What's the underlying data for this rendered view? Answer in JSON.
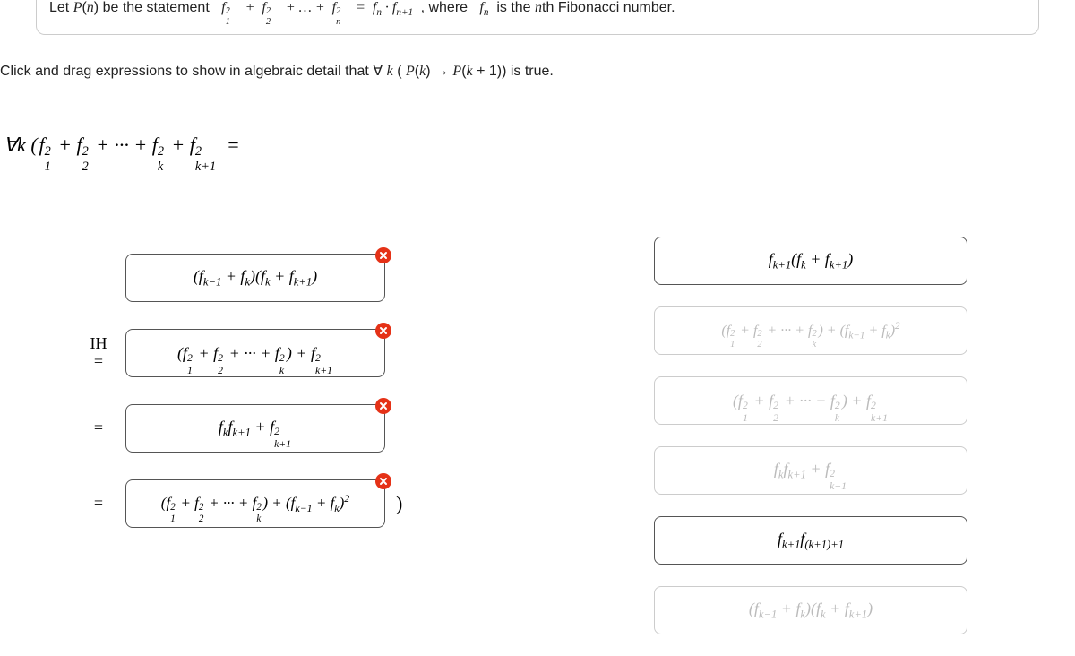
{
  "statement": {
    "pre": "Let ",
    "pn": "P(n)",
    "mid1": " be the statement  ",
    "eq_lhs": "f₁² + f₂² + … + fₙ² = fₙ · fₙ₊₁",
    "mid2": " , where  ",
    "fn": "fₙ",
    "mid3": "  is the ",
    "nth": "n",
    "mid4": "th Fibonacci number."
  },
  "instruction": {
    "pre": "Click and drag expressions to show in algebraic detail that ∀ ",
    "k": "k",
    "mid": "(",
    "pk": "P(k)",
    "arrow": " → ",
    "pk1": "P(k + 1)",
    "post": ") is true."
  },
  "lhs": "∀k ( f₁² + f₂² + ⋯ + fₖ² + fₖ₊₁²  =",
  "steps": [
    {
      "label": "",
      "expr": "(fₖ₋₁ + fₖ)(fₖ + fₖ₊₁)",
      "close": true
    },
    {
      "label": "IH\n=",
      "expr": "(f₁² + f₂² + ⋯ + fₖ²) + fₖ₊₁²",
      "close": true
    },
    {
      "label": "=",
      "expr": "fₖ fₖ₊₁ + fₖ₊₁²",
      "close": true
    },
    {
      "label": "=",
      "expr": "(f₁² + f₂² + ⋯ + fₖ²) + (fₖ₋₁ + fₖ)²",
      "close": true,
      "trailer": ")"
    }
  ],
  "pool": [
    {
      "expr": "fₖ₊₁(fₖ + fₖ₊₁)",
      "faded": false
    },
    {
      "expr": "(f₁² + f₂² + ⋯ + fₖ²) + (fₖ₋₁ + fₖ)²",
      "faded": true
    },
    {
      "expr": "(f₁² + f₂² + ⋯ + fₖ²) + fₖ₊₁²",
      "faded": true
    },
    {
      "expr": "fₖ fₖ₊₁ + fₖ₊₁²",
      "faded": true
    },
    {
      "expr": "fₖ₊₁ f₍ₖ₊₁₎₊₁",
      "faded": false
    },
    {
      "expr": "(fₖ₋₁ + fₖ)(fₖ + fₖ₊₁)",
      "faded": true
    }
  ]
}
